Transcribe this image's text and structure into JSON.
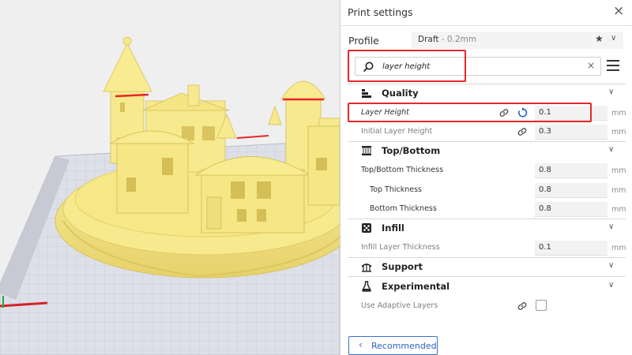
{
  "panel": {
    "title": "Print settings",
    "close_icon": "×"
  },
  "profile": {
    "label": "Profile",
    "name": "Draft",
    "sub": " - 0.2mm",
    "star_icon": "★",
    "chevron_icon": "∨"
  },
  "search": {
    "value": "layer height",
    "clear_icon": "×"
  },
  "categories": {
    "quality": "Quality",
    "topbottom": "Top/Bottom",
    "infill": "Infill",
    "support": "Support",
    "experimental": "Experimental",
    "chevron": "∨"
  },
  "settings": {
    "layer_height": {
      "label": "Layer Height",
      "value": "0.1",
      "unit": "mm"
    },
    "initial_layer_height": {
      "label": "Initial Layer Height",
      "value": "0.3",
      "unit": "mm"
    },
    "topbottom_thickness": {
      "label": "Top/Bottom Thickness",
      "value": "0.8",
      "unit": "mm"
    },
    "top_thickness": {
      "label": "Top Thickness",
      "value": "0.8",
      "unit": "mm"
    },
    "bottom_thickness": {
      "label": "Bottom Thickness",
      "value": "0.8",
      "unit": "mm"
    },
    "infill_layer_thickness": {
      "label": "Infill Layer Thickness",
      "value": "0.1",
      "unit": "mm"
    },
    "adaptive_layers": {
      "label": "Use Adaptive Layers",
      "checked": false
    }
  },
  "recommended": {
    "label": "Recommended",
    "chevron_icon": "‹"
  },
  "colors": {
    "model": "#f7e98e",
    "model_shade": "#e3cf6a",
    "highlight": "#e8262a",
    "accent": "#2f62c8",
    "bed_grid": "#c9ccd6"
  }
}
